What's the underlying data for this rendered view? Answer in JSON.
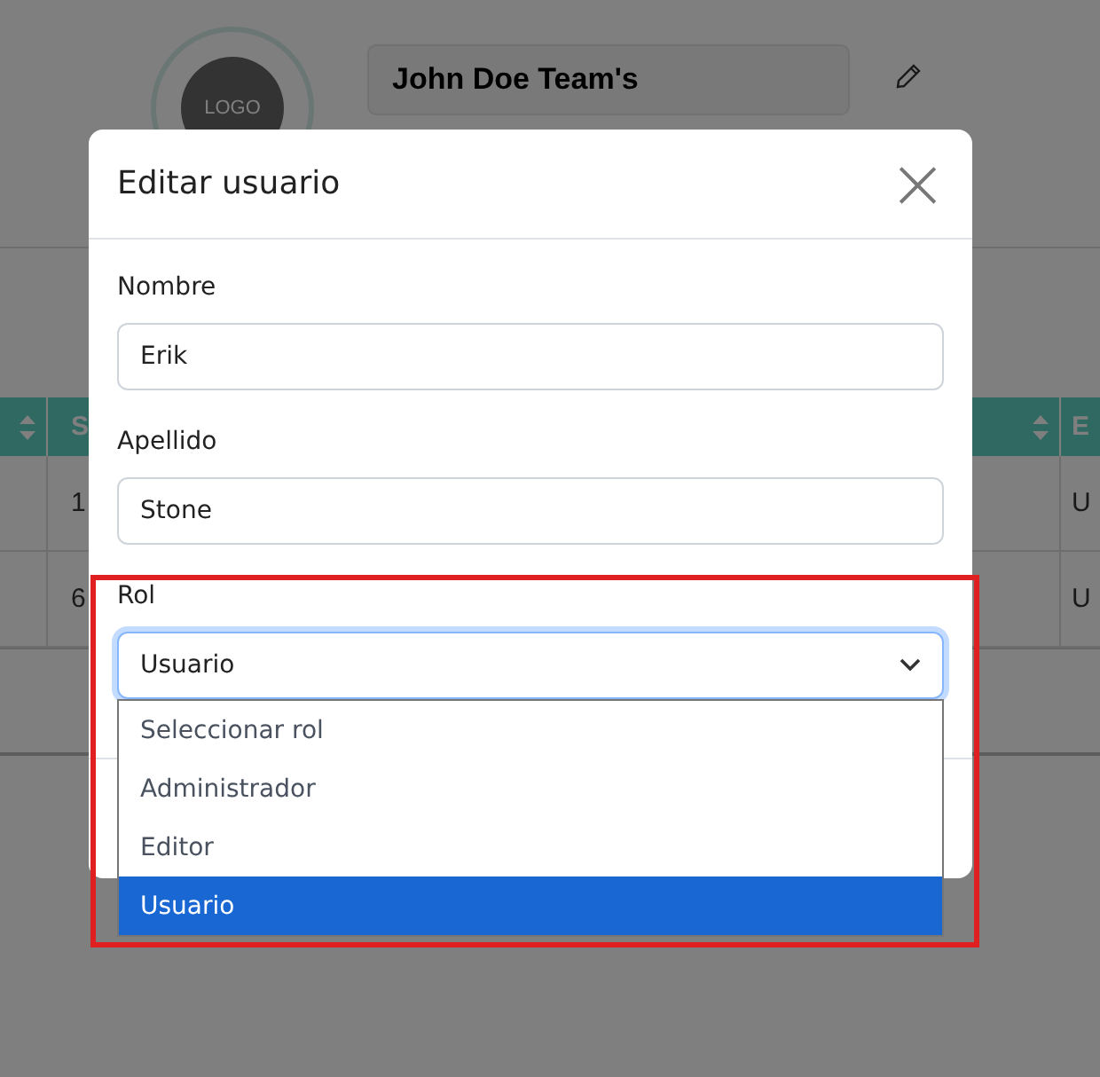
{
  "page": {
    "logo": {
      "label": "LOGO"
    },
    "team_name": {
      "value": "John Doe Team's"
    },
    "table": {
      "columns": [
        {
          "sortable": true
        },
        {
          "label": "S",
          "sortable": false
        },
        {
          "sortable": true
        },
        {
          "label": "E",
          "sortable": false
        }
      ],
      "rows": [
        {
          "column_2": "1",
          "column_4": "U"
        },
        {
          "column_2": "6",
          "column_4": "U"
        }
      ]
    }
  },
  "modal": {
    "title": "Editar usuario",
    "close": "×",
    "fields": [
      {
        "kind": "text",
        "label": "Nombre",
        "value": "Erik"
      },
      {
        "kind": "text",
        "label": "Apellido",
        "value": "Stone"
      },
      {
        "kind": "select",
        "label": "Rol",
        "value": "Usuario",
        "focused": true,
        "expanded": true,
        "options": [
          {
            "label": "Seleccionar rol",
            "selected": false
          },
          {
            "label": "Administrador",
            "selected": false
          },
          {
            "label": "Editor",
            "selected": false
          },
          {
            "label": "Usuario",
            "selected": true
          }
        ]
      }
    ]
  }
}
